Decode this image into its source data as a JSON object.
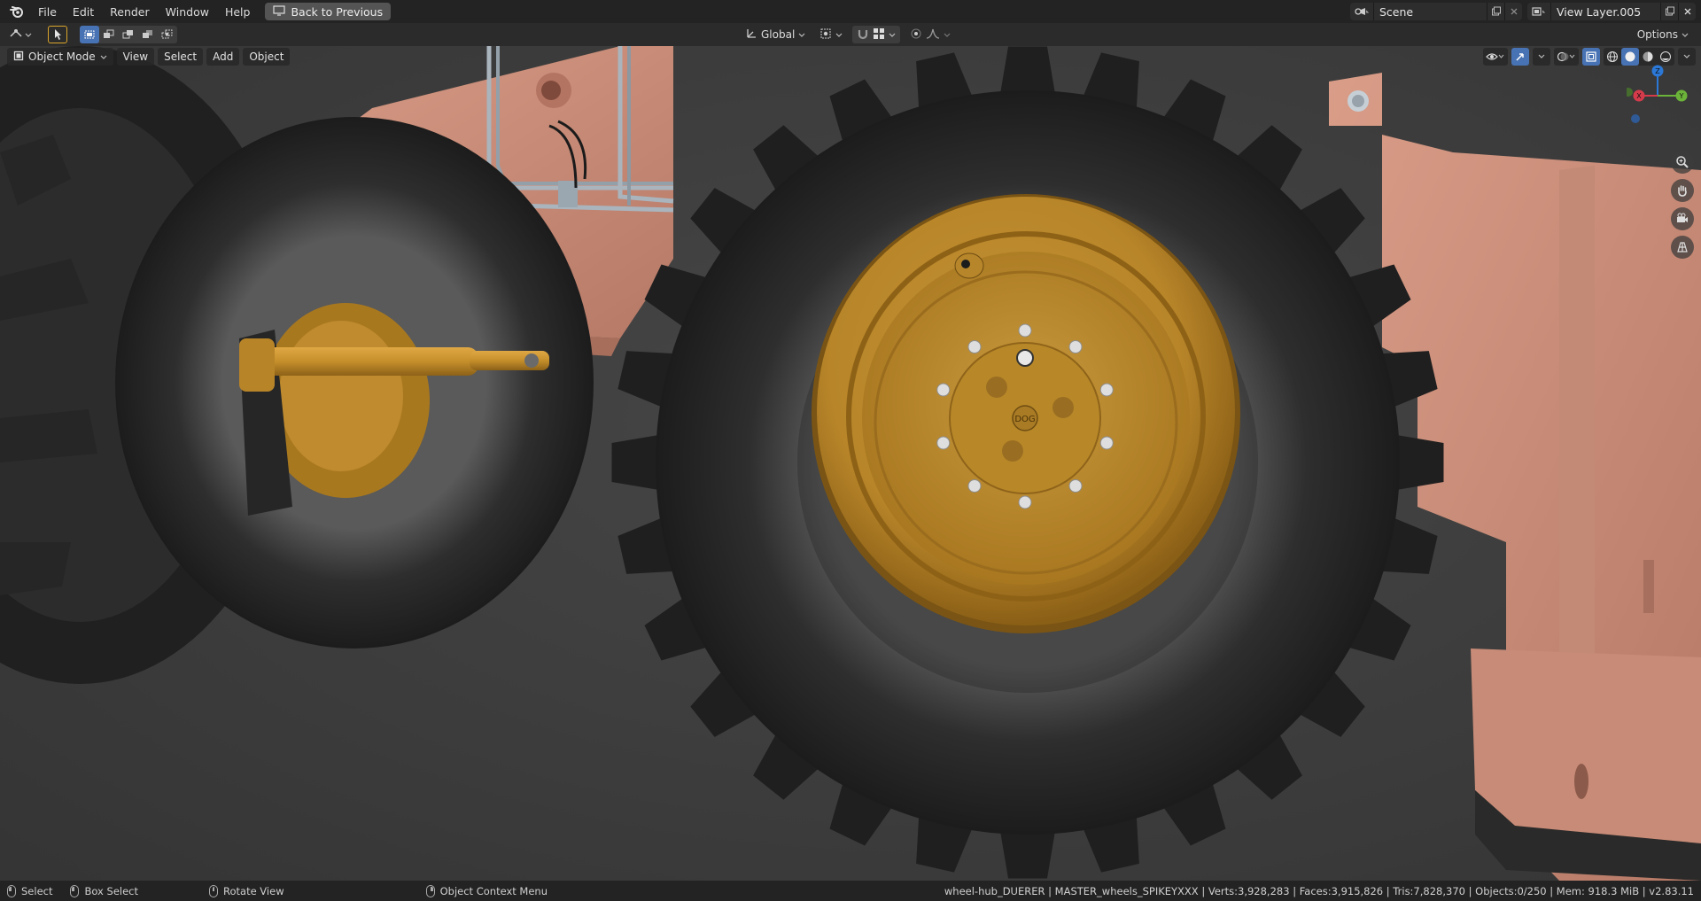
{
  "menu": {
    "file": "File",
    "edit": "Edit",
    "render": "Render",
    "window": "Window",
    "help": "Help",
    "back_button": "Back to Previous"
  },
  "scene": {
    "name": "Scene"
  },
  "view_layer": {
    "name": "View Layer.005"
  },
  "header": {
    "transform_orientation": "Global",
    "options": "Options"
  },
  "viewport": {
    "mode": "Object Mode",
    "menus": {
      "view": "View",
      "select": "Select",
      "add": "Add",
      "object": "Object"
    },
    "hub_label": "DOG",
    "gizmo": {
      "z": "Z",
      "x": "X",
      "y": "Y"
    }
  },
  "status": {
    "select": "Select",
    "box_select": "Box Select",
    "rotate_view": "Rotate View",
    "context_menu": "Object Context Menu",
    "stats": "wheel-hub_DUERER | MASTER_wheels_SPIKEYXXX | Verts:3,928,283 | Faces:3,915,826 | Tris:7,828,370 | Objects:0/250 | Mem: 918.3 MiB | v2.83.11"
  },
  "colors": {
    "accent": "#4772b3",
    "rim": "#c9953a",
    "frame": "#d2937e",
    "tire": "#262626"
  }
}
